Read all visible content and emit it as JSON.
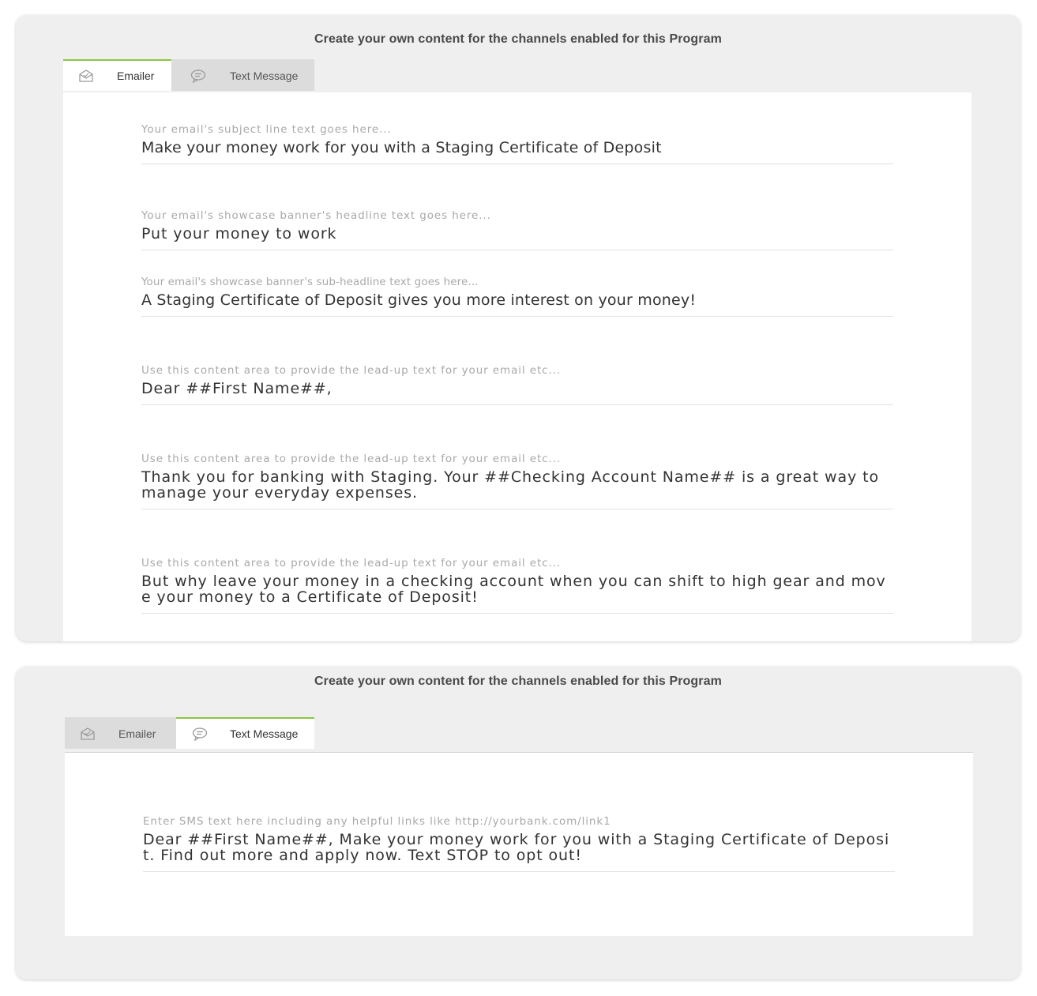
{
  "email_panel": {
    "title": "Create your own content for the channels enabled for this Program",
    "tabs": [
      {
        "label": "Emailer",
        "icon": "envelope-icon",
        "active": true
      },
      {
        "label": "Text Message",
        "icon": "chat-bubble-icon",
        "active": false
      }
    ],
    "fields": [
      {
        "placeholder": "Your email's subject line text goes here...",
        "value": "Make your money work for you with a Staging Certificate of Deposit"
      },
      {
        "placeholder": "Your email's showcase banner's headline text goes here...",
        "value": "Put your money to work"
      },
      {
        "placeholder": "Your email's showcase banner's sub-headline text goes here...",
        "value": "A Staging Certificate of Deposit gives you more interest on your money!"
      },
      {
        "placeholder": "Use this content area to provide the lead-up text for your email etc...",
        "value": "Dear ##First Name##,"
      },
      {
        "placeholder": "Use this content area to provide the lead-up text for your email etc...",
        "value": "Thank you for banking with Staging. Your ##Checking Account Name## is a great way to manage your everyday expenses."
      },
      {
        "placeholder": "Use this content area to provide the lead-up text for your email etc...",
        "value": "But why leave your money in a checking account when you can shift to high gear and move your money to a Certificate of Deposit!"
      }
    ]
  },
  "sms_panel": {
    "title": "Create your own content for the channels enabled for this Program",
    "tabs": [
      {
        "label": "Emailer",
        "icon": "envelope-icon",
        "active": false
      },
      {
        "label": "Text Message",
        "icon": "chat-bubble-icon",
        "active": true
      }
    ],
    "field": {
      "placeholder": "Enter SMS text here including any helpful links like http://yourbank.com/link1",
      "value": "Dear ##First Name##, Make your money work for you with a Staging Certificate of Deposit. Find out more and apply now. Text STOP to opt out!"
    }
  },
  "colors": {
    "accent": "#8cc63f",
    "panel_bg": "#efefef",
    "inactive_tab": "#dcdcdc"
  }
}
